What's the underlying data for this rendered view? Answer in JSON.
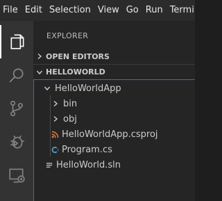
{
  "menubar": {
    "items": [
      {
        "label": "File"
      },
      {
        "label": "Edit"
      },
      {
        "label": "Selection"
      },
      {
        "label": "View"
      },
      {
        "label": "Go"
      },
      {
        "label": "Run"
      },
      {
        "label": "Terminal"
      }
    ]
  },
  "activitybar": {
    "icons": [
      "explorer-icon",
      "search-icon",
      "source-control-icon",
      "run-debug-icon",
      "remote-explorer-icon"
    ]
  },
  "sidebar": {
    "title": "EXPLORER",
    "open_editors_label": "OPEN EDITORS",
    "workspace_label": "HELLOWORLD",
    "tree": {
      "folder": "HelloWorldApp",
      "bin": "bin",
      "obj": "obj",
      "csproj": "HelloWorldApp.csproj",
      "program": "Program.cs",
      "sln": "HelloWorld.sln"
    }
  },
  "colors": {
    "accent": "#3a6ea5",
    "rss_orange": "#e37933",
    "csharp_blue": "#519aba"
  }
}
